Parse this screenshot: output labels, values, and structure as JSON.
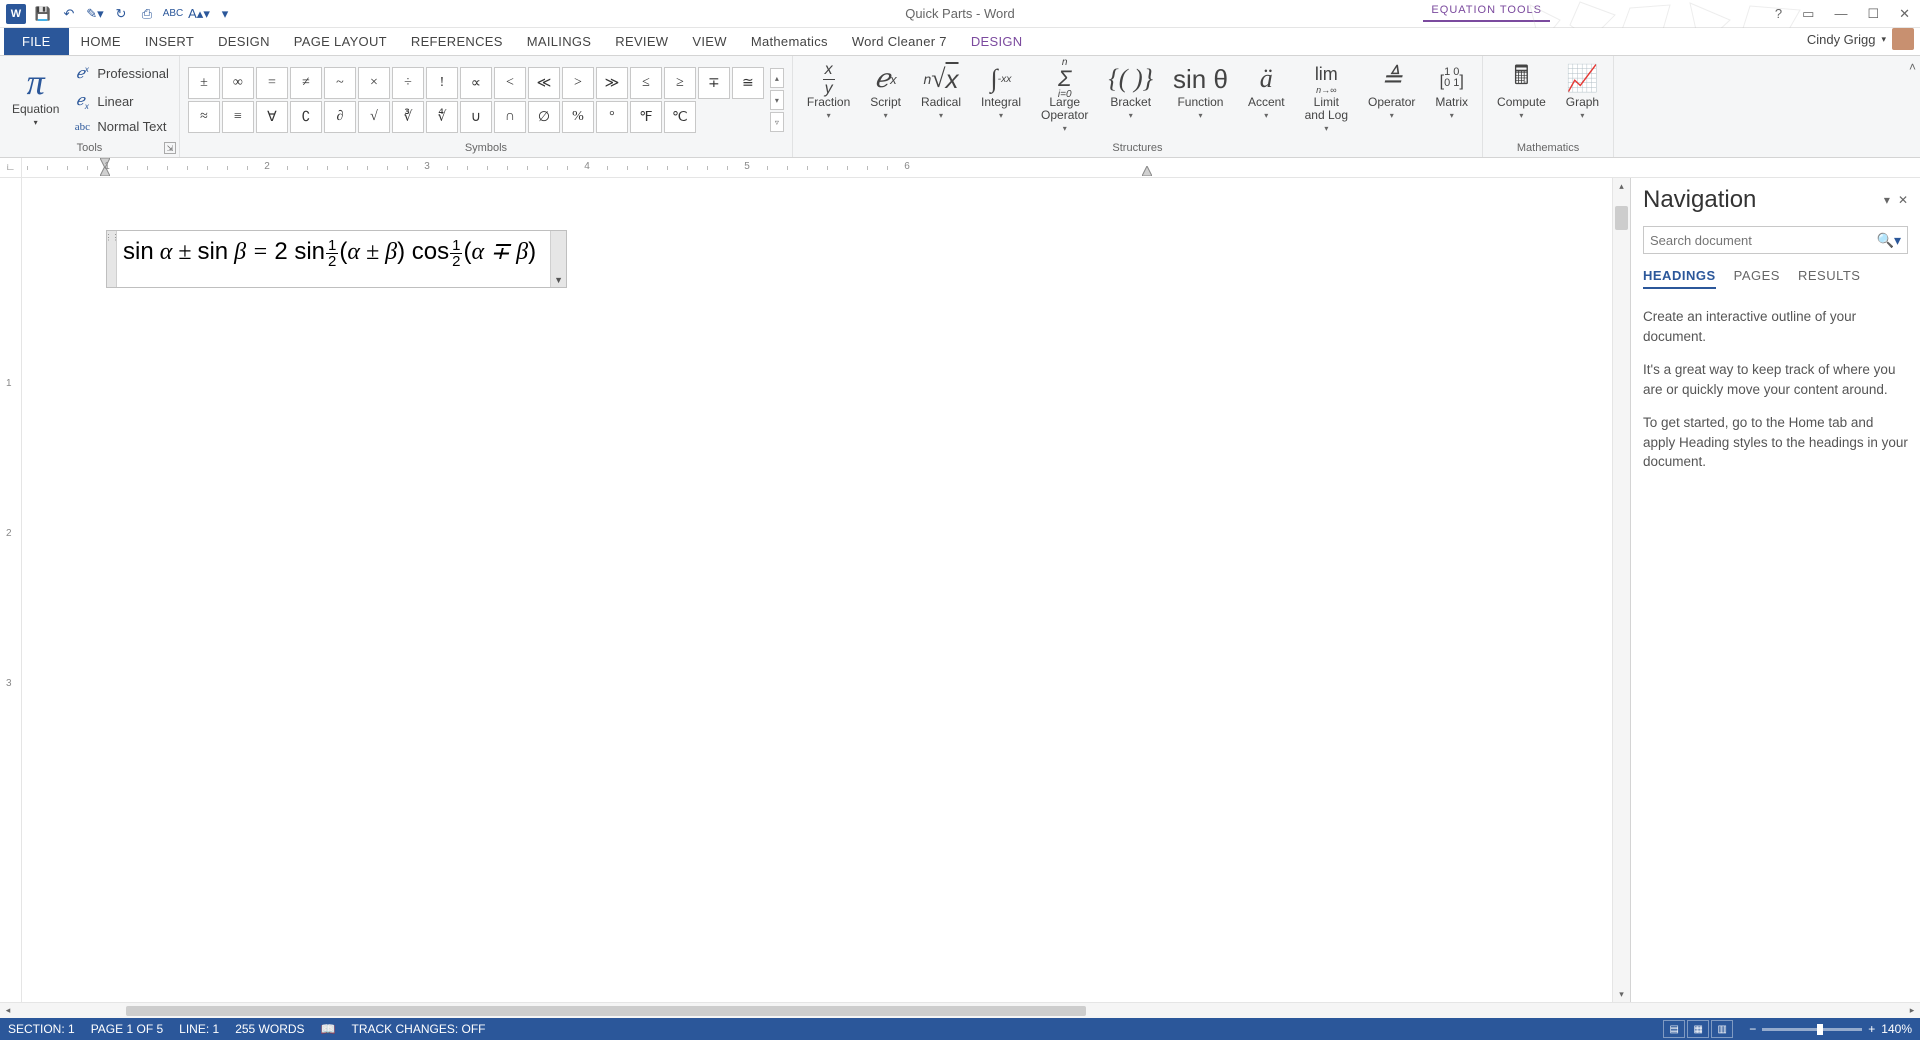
{
  "title": "Quick Parts - Word",
  "contextTab": "EQUATION TOOLS",
  "user": "Cindy Grigg",
  "tabs": [
    "FILE",
    "HOME",
    "INSERT",
    "DESIGN",
    "PAGE LAYOUT",
    "REFERENCES",
    "MAILINGS",
    "REVIEW",
    "VIEW",
    "Mathematics",
    "Word Cleaner 7",
    "DESIGN"
  ],
  "activeTabIndex": 11,
  "tools": {
    "equation": "Equation",
    "professional": "Professional",
    "linear": "Linear",
    "normal": "Normal Text",
    "groupLabel": "Tools"
  },
  "symbols": {
    "groupLabel": "Symbols",
    "row1": [
      "±",
      "∞",
      "=",
      "≠",
      "~",
      "×",
      "÷",
      "!",
      "∝",
      "<",
      "≪",
      ">",
      "≫",
      "≤",
      "≥",
      "∓"
    ],
    "row2": [
      "≅",
      "≈",
      "≡",
      "∀",
      "∁",
      "∂",
      "√",
      "∛",
      "∜",
      "∪",
      "∩",
      "∅",
      "%",
      "°",
      "℉",
      "℃"
    ]
  },
  "structures": {
    "groupLabel": "Structures",
    "items": [
      {
        "label": "Fraction"
      },
      {
        "label": "Script"
      },
      {
        "label": "Radical"
      },
      {
        "label": "Integral"
      },
      {
        "label": "Large Operator"
      },
      {
        "label": "Bracket"
      },
      {
        "label": "Function"
      },
      {
        "label": "Accent"
      },
      {
        "label": "Limit and Log"
      },
      {
        "label": "Operator"
      },
      {
        "label": "Matrix"
      }
    ]
  },
  "math": {
    "groupLabel": "Mathematics",
    "compute": "Compute",
    "graph": "Graph"
  },
  "equation": {
    "display_tex": "sin α ± sin β = 2 sin ½(α ± β) cos ½(α ∓ β)"
  },
  "nav": {
    "title": "Navigation",
    "searchPlaceholder": "Search document",
    "tabs": [
      "HEADINGS",
      "PAGES",
      "RESULTS"
    ],
    "activeTab": 0,
    "para1": "Create an interactive outline of your document.",
    "para2": "It's a great way to keep track of where you are or quickly move your content around.",
    "para3": "To get started, go to the Home tab and apply Heading styles to the headings in your document."
  },
  "status": {
    "section": "SECTION: 1",
    "page": "PAGE 1 OF 5",
    "line": "LINE: 1",
    "words": "255 WORDS",
    "track": "TRACK CHANGES: OFF",
    "zoom": "140%"
  },
  "ruler": {
    "numbers": [
      1,
      2,
      3,
      4,
      5,
      6
    ]
  }
}
